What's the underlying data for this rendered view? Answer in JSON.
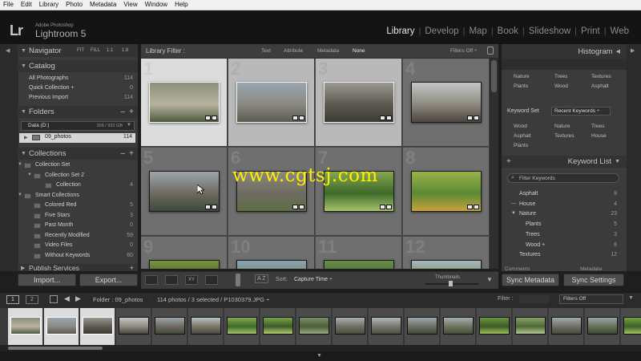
{
  "os_menu": [
    "File",
    "Edit",
    "Library",
    "Photo",
    "Metadata",
    "View",
    "Window",
    "Help"
  ],
  "identity": {
    "logo": "Lr",
    "adobe": "Adobe Photoshop",
    "product": "Lightroom 5"
  },
  "modules": [
    {
      "label": "Library",
      "active": true
    },
    {
      "label": "Develop",
      "active": false
    },
    {
      "label": "Map",
      "active": false
    },
    {
      "label": "Book",
      "active": false
    },
    {
      "label": "Slideshow",
      "active": false
    },
    {
      "label": "Print",
      "active": false
    },
    {
      "label": "Web",
      "active": false
    }
  ],
  "left": {
    "navigator": {
      "title": "Navigator",
      "zoom": [
        "FIT",
        "FILL",
        "1:1",
        "1:8"
      ]
    },
    "catalog": {
      "title": "Catalog",
      "items": [
        {
          "label": "All Photographs",
          "count": "114"
        },
        {
          "label": "Quick Collection +",
          "count": "0"
        },
        {
          "label": "Previous Import",
          "count": "114"
        }
      ]
    },
    "folders": {
      "title": "Folders",
      "plus": "+",
      "minus": "–",
      "volume": {
        "label": "Data (D:)",
        "info": "309 / 932 GB"
      },
      "items": [
        {
          "label": "09_photos",
          "count": "114"
        }
      ]
    },
    "collections": {
      "title": "Collections",
      "plus": "+",
      "minus": "–",
      "items": [
        {
          "label": "Collection Set",
          "count": ""
        },
        {
          "label": "Collection Set 2",
          "count": ""
        },
        {
          "label": "Collection",
          "count": "4"
        },
        {
          "label": "Smart Collections",
          "count": ""
        },
        {
          "label": "Colored Red",
          "count": "5"
        },
        {
          "label": "Five Stars",
          "count": "3"
        },
        {
          "label": "Past Month",
          "count": "0"
        },
        {
          "label": "Recently Modified",
          "count": "59"
        },
        {
          "label": "Video Files",
          "count": "0"
        },
        {
          "label": "Without Keywords",
          "count": "60"
        }
      ]
    },
    "publish": {
      "title": "Publish Services",
      "plus": "+"
    },
    "buttons": {
      "import": "Import...",
      "export": "Export..."
    }
  },
  "filter_bar": {
    "title": "Library Filter :",
    "tabs": [
      {
        "label": "Text",
        "active": false
      },
      {
        "label": "Attribute",
        "active": false
      },
      {
        "label": "Metadata",
        "active": false
      },
      {
        "label": "None",
        "active": true
      }
    ],
    "preset": "Filters Off ÷"
  },
  "grid": {
    "cells": [
      {
        "num": "1",
        "state": "sel",
        "thumb": [
          "#8a8f7a",
          "#b9b2a0",
          "#4e5a3c"
        ]
      },
      {
        "num": "2",
        "state": "selm",
        "thumb": [
          "#9aa6b0",
          "#8a8a82",
          "#5b5b52"
        ]
      },
      {
        "num": "3",
        "state": "selm",
        "thumb": [
          "#9a9890",
          "#5e5a52",
          "#3c3a34"
        ]
      },
      {
        "num": "4",
        "state": "",
        "thumb": [
          "#c3c7c5",
          "#8e8a80",
          "#4a4640"
        ]
      },
      {
        "num": "5",
        "state": "",
        "thumb": [
          "#9ca6ad",
          "#6e6a60",
          "#3f4a3a"
        ]
      },
      {
        "num": "6",
        "state": "",
        "thumb": [
          "#8b8a7f",
          "#6e6b60",
          "#5f6d44"
        ]
      },
      {
        "num": "7",
        "state": "",
        "thumb": [
          "#86a650",
          "#3e6a2a",
          "#a6c46a"
        ]
      },
      {
        "num": "8",
        "state": "",
        "thumb": [
          "#9ab34a",
          "#5a8a34",
          "#c8a23a"
        ]
      },
      {
        "num": "9",
        "state": "",
        "thumb": [
          "#77923e",
          "#3e5a24",
          "#9ab058"
        ]
      },
      {
        "num": "10",
        "state": "",
        "thumb": [
          "#8ba2b5",
          "#6f8a40",
          "#3c5a28"
        ]
      },
      {
        "num": "11",
        "state": "",
        "thumb": [
          "#6a8f4a",
          "#3a5e28",
          "#9ab86a"
        ]
      },
      {
        "num": "12",
        "state": "",
        "thumb": [
          "#a8b8c0",
          "#6a8a44",
          "#3a5424"
        ]
      }
    ]
  },
  "toolbar": {
    "sort_label": "Sort:",
    "sort_value": "Capture Time ÷",
    "thumbnails_label": "Thumbnails",
    "az": "A Z"
  },
  "right": {
    "histogram": {
      "title": "Histogram"
    },
    "keywords_top": [
      [
        "Nature",
        "Trees",
        "Textures"
      ],
      [
        "Plants",
        "Wood",
        "Asphalt"
      ]
    ],
    "keyword_set": {
      "label": "Keyword Set",
      "value": "Recent Keywords ÷"
    },
    "keywords_recent": [
      [
        "Wood",
        "Nature",
        "Trees"
      ],
      [
        "Asphalt",
        "Textures",
        "House"
      ],
      [
        "Plants",
        "",
        ""
      ]
    ],
    "keyword_list": {
      "title": "Keyword List",
      "plus": "+",
      "minus": "–",
      "filter_placeholder": "Filter Keywords",
      "items": [
        {
          "label": "Asphalt",
          "count": "9"
        },
        {
          "label": "House",
          "count": "4"
        },
        {
          "label": "Nature",
          "count": "23"
        },
        {
          "label": "Plants",
          "count": "5"
        },
        {
          "label": "Trees",
          "count": "3"
        },
        {
          "label": "Wood +",
          "count": "8"
        },
        {
          "label": "Textures",
          "count": "12"
        }
      ]
    },
    "lower_tabs": [
      "Comments",
      "Metadata"
    ],
    "buttons": {
      "sync_metadata": "Sync Metadata",
      "sync_settings": "Sync Settings"
    }
  },
  "filmstrip_bar": {
    "view1": "1",
    "view2": "2",
    "folder": "Folder : 09_photos",
    "summary": "114 photos / 3 selected / P1030379.JPG ÷",
    "filter_label": "Filter :",
    "filter_value": "Filters Off"
  },
  "filmstrip": {
    "cells": [
      {
        "state": "sel",
        "c": [
          "#8a8f7a",
          "#b9b2a0",
          "#4e5a3c"
        ]
      },
      {
        "state": "sel",
        "c": [
          "#9aa6b0",
          "#8a8a82",
          "#5b5b52"
        ]
      },
      {
        "state": "sel",
        "c": [
          "#9a9890",
          "#5e5a52",
          "#3c3a34"
        ]
      },
      {
        "state": "",
        "c": [
          "#c3c7c5",
          "#8e8a80",
          "#4a4640"
        ]
      },
      {
        "state": "",
        "c": [
          "#9ca6ad",
          "#6e6a60",
          "#3f4a3a"
        ]
      },
      {
        "state": "",
        "c": [
          "#b8c2c8",
          "#7a7668",
          "#4b4a42"
        ]
      },
      {
        "state": "",
        "c": [
          "#86a650",
          "#3e6a2a",
          "#a6c46a"
        ]
      },
      {
        "state": "",
        "c": [
          "#7aa048",
          "#3a5e2a",
          "#b4cc70"
        ]
      },
      {
        "state": "",
        "c": [
          "#7a8e6a",
          "#4b5e3a",
          "#9aa882"
        ]
      },
      {
        "state": "",
        "c": [
          "#a8b0b6",
          "#6e7060",
          "#4a4c40"
        ]
      },
      {
        "state": "",
        "c": [
          "#b0b8be",
          "#77786a",
          "#4e5044"
        ]
      },
      {
        "state": "",
        "c": [
          "#9aa6ad",
          "#6e6e62",
          "#3e4a36"
        ]
      },
      {
        "state": "",
        "c": [
          "#a4aeb4",
          "#6f735f",
          "#45503a"
        ]
      },
      {
        "state": "",
        "c": [
          "#6e9440",
          "#3a5a24",
          "#a0c05a"
        ]
      },
      {
        "state": "",
        "c": [
          "#8aa068",
          "#4e6a3a",
          "#b8c890"
        ]
      },
      {
        "state": "",
        "c": [
          "#a0aab0",
          "#706f64",
          "#4a4a40"
        ]
      },
      {
        "state": "",
        "c": [
          "#9aa6ad",
          "#6a7058",
          "#3a4a34"
        ]
      },
      {
        "state": "",
        "c": [
          "#78a044",
          "#3e6028",
          "#a2c25e"
        ]
      }
    ]
  }
}
